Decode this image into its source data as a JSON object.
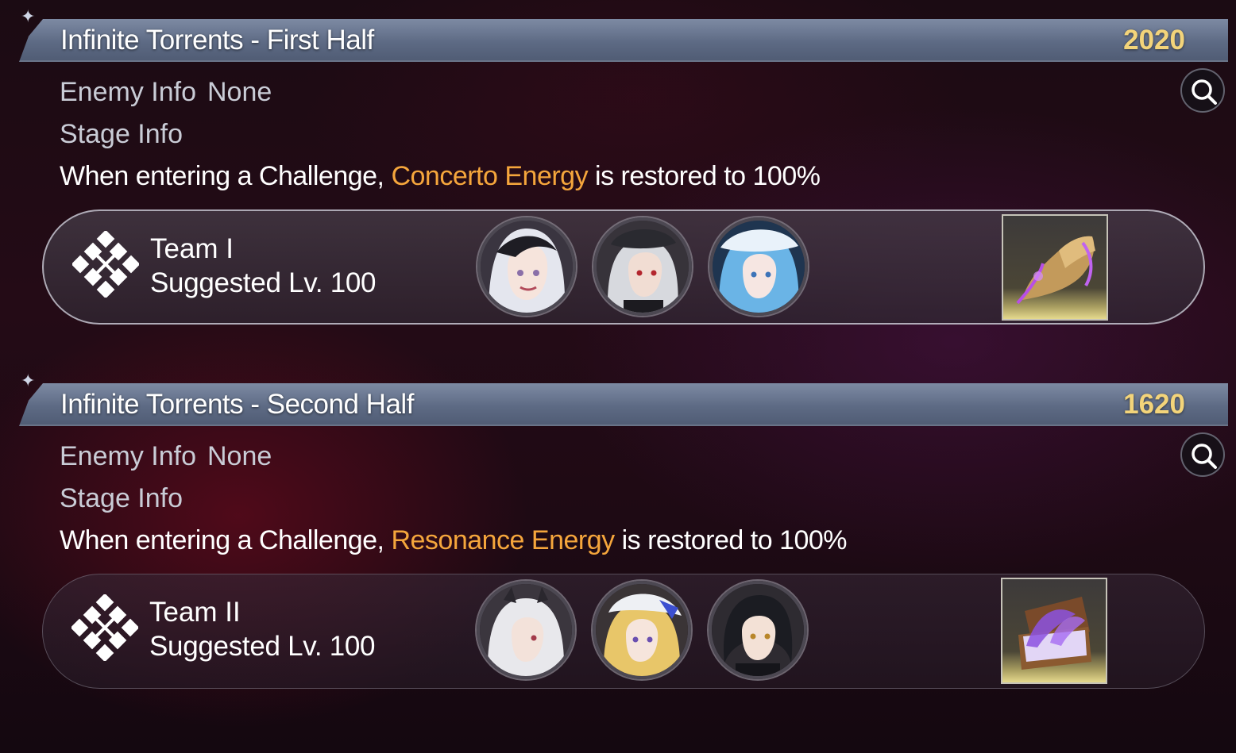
{
  "stages": [
    {
      "title": "Infinite Torrents - First Half",
      "score": "2020",
      "enemy_info_label": "Enemy Info",
      "enemy_info_value": "None",
      "stage_info_label": "Stage Info",
      "effect_prefix": "When entering a Challenge, ",
      "effect_highlight": "Concerto Energy",
      "effect_suffix": " is restored to 100%",
      "team_name": "Team I",
      "suggested_level": "Suggested Lv. 100",
      "characters": [
        "character-portrait-silver-hair-twin-tails",
        "character-portrait-silver-hair-beret",
        "character-portrait-blue-hair-hat"
      ],
      "reward_icon": "golden-glove-reward-icon"
    },
    {
      "title": "Infinite Torrents - Second Half",
      "score": "1620",
      "enemy_info_label": "Enemy Info",
      "enemy_info_value": "None",
      "stage_info_label": "Stage Info",
      "effect_prefix": "When entering a Challenge, ",
      "effect_highlight": "Resonance Energy",
      "effect_suffix": " is restored to 100%",
      "team_name": "Team II",
      "suggested_level": "Suggested Lv. 100",
      "characters": [
        "character-portrait-white-hair-horns",
        "character-portrait-blonde-hair-white-hat",
        "character-portrait-black-hair"
      ],
      "reward_icon": "purple-chest-reward-icon"
    }
  ],
  "colors": {
    "header_bar": "#5d6a84",
    "score": "#f3d47a",
    "highlight": "#f5a63c",
    "info_label": "#c9ccd6"
  }
}
